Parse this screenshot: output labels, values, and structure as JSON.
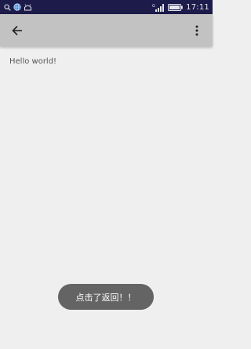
{
  "status_bar": {
    "time": "17:11",
    "network_label": "G",
    "icons": [
      "search-icon",
      "globe-icon",
      "android-icon",
      "signal-icon",
      "battery-icon"
    ]
  },
  "app_bar": {
    "back_icon": "arrow-left-icon",
    "overflow_icon": "more-vert-icon"
  },
  "content": {
    "text": "Hello world!"
  },
  "toast": {
    "message": "点击了返回！！"
  },
  "colors": {
    "status_bar_bg": "#1d1b4a",
    "app_bar_bg": "#c2c2c2",
    "page_bg": "#f0efef",
    "toast_bg": "#646464"
  }
}
